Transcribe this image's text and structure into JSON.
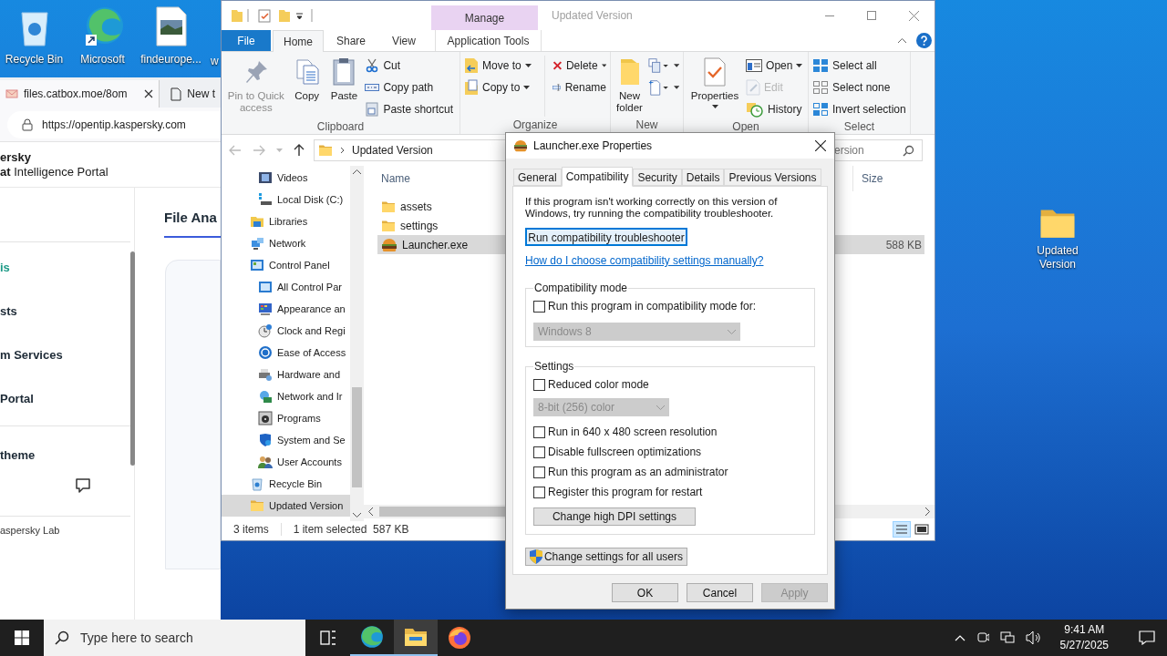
{
  "desktop_icons": [
    {
      "label": "Recycle Bin",
      "kind": "recycle_bin"
    },
    {
      "label": "Microsoft",
      "kind": "edge"
    },
    {
      "label": "findeurope...",
      "kind": "image_file"
    },
    {
      "label": "w",
      "kind": "covered"
    }
  ],
  "desktop_folder": {
    "label": "Updated Version"
  },
  "browser": {
    "tabs": [
      {
        "label": "files.catbox.moe/8om",
        "selected": true,
        "closable": true
      },
      {
        "label": "New t",
        "selected": false,
        "closable": false
      }
    ],
    "url": "https://opentip.kaspersky.com",
    "brand": "ersky",
    "portal_title": "**at** Intelligence Portal",
    "nav_items": [
      {
        "label": "is",
        "selected": true
      },
      {
        "label": "sts",
        "selected": false
      },
      {
        "label": "m Services",
        "selected": false
      },
      {
        "label": "Portal",
        "selected": false
      }
    ],
    "theme_label": "theme",
    "footer": "aspersky Lab",
    "heading": "File Ana"
  },
  "explorer": {
    "title": "Updated Version",
    "context_tab": "Manage",
    "ribbon_tabs": [
      {
        "label": "File",
        "kind": "file",
        "selected": false
      },
      {
        "label": "Home",
        "kind": "tab",
        "selected": true
      },
      {
        "label": "Share",
        "kind": "tab",
        "selected": false
      },
      {
        "label": "View",
        "kind": "tab",
        "selected": false
      },
      {
        "label": "Application Tools",
        "kind": "tab",
        "selected": false
      }
    ],
    "ribbon_groups": [
      {
        "label": "Clipboard",
        "items": [
          {
            "kind": "large",
            "label": "Pin to Quick access",
            "disabled": true,
            "dropdown": false
          },
          {
            "kind": "large",
            "label": "Copy",
            "disabled": false,
            "dropdown": false
          },
          {
            "kind": "large",
            "label": "Paste",
            "disabled": false,
            "dropdown": false
          },
          {
            "kind": "stack",
            "items": [
              {
                "label": "Cut",
                "disabled": false,
                "dropdown": false
              },
              {
                "label": "Copy path",
                "disabled": false,
                "dropdown": false
              },
              {
                "label": "Paste shortcut",
                "disabled": false,
                "dropdown": false
              }
            ]
          }
        ]
      },
      {
        "label": "Organize",
        "items": [
          {
            "kind": "stack",
            "items": [
              {
                "label": "Move to",
                "disabled": false,
                "dropdown": true
              },
              {
                "label": "Copy to",
                "disabled": false,
                "dropdown": true
              }
            ]
          },
          {
            "kind": "stack",
            "items": [
              {
                "label": "Delete",
                "disabled": false,
                "dropdown": true
              },
              {
                "label": "Rename",
                "disabled": false,
                "dropdown": false
              }
            ]
          }
        ]
      },
      {
        "label": "New",
        "items": [
          {
            "kind": "large",
            "label": "New folder",
            "disabled": false,
            "dropdown": false
          },
          {
            "kind": "stack",
            "items": [
              {
                "disabled": false,
                "dropdown": true
              },
              {
                "disabled": false,
                "dropdown": true
              }
            ]
          }
        ]
      },
      {
        "label": "Open",
        "items": [
          {
            "kind": "large",
            "label": "Properties",
            "disabled": false,
            "dropdown": true
          },
          {
            "kind": "stack",
            "items": [
              {
                "label": "Open",
                "disabled": false,
                "dropdown": true
              },
              {
                "label": "Edit",
                "disabled": true,
                "dropdown": false
              },
              {
                "label": "History",
                "disabled": false,
                "dropdown": false
              }
            ]
          }
        ]
      },
      {
        "label": "Select",
        "items": [
          {
            "kind": "stack",
            "items": [
              {
                "label": "Select all",
                "disabled": false,
                "dropdown": false
              },
              {
                "label": "Select none",
                "disabled": false,
                "dropdown": false
              },
              {
                "label": "Invert selection",
                "disabled": false,
                "dropdown": false
              }
            ]
          }
        ]
      }
    ],
    "address": "Updated Version",
    "search_placeholder": "ersion",
    "nav_tree_continued": [
      {
        "label": "Videos",
        "selected": false
      },
      {
        "label": "Local Disk (C:)",
        "selected": false
      }
    ],
    "nav_tree": [
      {
        "label": "Libraries",
        "selected": false
      },
      {
        "label": "Network",
        "selected": false
      },
      {
        "label": "Control Panel",
        "selected": false,
        "children": [
          {
            "label": "All Control Par",
            "selected": false
          },
          {
            "label": "Appearance an",
            "selected": false
          },
          {
            "label": "Clock and Regi",
            "selected": false
          },
          {
            "label": "Ease of Access",
            "selected": false
          },
          {
            "label": "Hardware and",
            "selected": false
          },
          {
            "label": "Network and Ir",
            "selected": false
          },
          {
            "label": "Programs",
            "selected": false
          },
          {
            "label": "System and Se",
            "selected": false
          },
          {
            "label": "User Accounts",
            "selected": false
          }
        ]
      },
      {
        "label": "Recycle Bin",
        "selected": false
      },
      {
        "label": "Updated Version",
        "selected": true
      }
    ],
    "columns": [
      "Name",
      "Size"
    ],
    "files": [
      {
        "name": "assets",
        "kind": "folder",
        "selected": false
      },
      {
        "name": "settings",
        "kind": "folder",
        "selected": false
      },
      {
        "name": "Launcher.exe",
        "kind": "exe",
        "size": "588 KB",
        "selected": true
      }
    ],
    "status_items": "3 items",
    "status_selection": "1 item selected  587 KB"
  },
  "dialog": {
    "title": "Launcher.exe Properties",
    "tabs": [
      {
        "label": "General",
        "selected": false
      },
      {
        "label": "Compatibility",
        "selected": true
      },
      {
        "label": "Security",
        "selected": false
      },
      {
        "label": "Details",
        "selected": false
      },
      {
        "label": "Previous Versions",
        "selected": false
      }
    ],
    "intro": "If this program isn't working correctly on this version of Windows, try running the compatibility troubleshooter.",
    "troubleshooter_button": "Run compatibility troubleshooter",
    "help_link": "How do I choose compatibility settings manually?",
    "compat_group": {
      "title": "Compatibility mode",
      "checkbox": {
        "label": "Run this program in compatibility mode for:",
        "checked": false
      },
      "select": {
        "value": "Windows 8",
        "disabled": true
      }
    },
    "settings_group": {
      "title": "Settings",
      "options": [
        {
          "kind": "checkbox",
          "label": "Reduced color mode",
          "checked": false
        },
        {
          "kind": "select",
          "value": "8-bit (256) color",
          "disabled": true
        },
        {
          "kind": "checkbox",
          "label": "Run in 640 x 480 screen resolution",
          "checked": false
        },
        {
          "kind": "checkbox",
          "label": "Disable fullscreen optimizations",
          "checked": false
        },
        {
          "kind": "checkbox",
          "label": "Run this program as an administrator",
          "checked": false
        },
        {
          "kind": "checkbox",
          "label": "Register this program for restart",
          "checked": false
        },
        {
          "kind": "button",
          "label": "Change high DPI settings"
        }
      ]
    },
    "all_users_button": "Change settings for all users",
    "buttons": [
      {
        "label": "OK",
        "disabled": false
      },
      {
        "label": "Cancel",
        "disabled": false
      },
      {
        "label": "Apply",
        "disabled": true
      }
    ]
  },
  "taskbar": {
    "search_placeholder": "Type here to search",
    "apps": [
      {
        "kind": "task_view",
        "running": false,
        "active": false
      },
      {
        "kind": "edge",
        "running": true,
        "active": false
      },
      {
        "kind": "explorer",
        "running": true,
        "active": true
      },
      {
        "kind": "firefox",
        "running": false,
        "active": false
      }
    ],
    "time": "9:41 AM",
    "date": "5/27/2025"
  }
}
